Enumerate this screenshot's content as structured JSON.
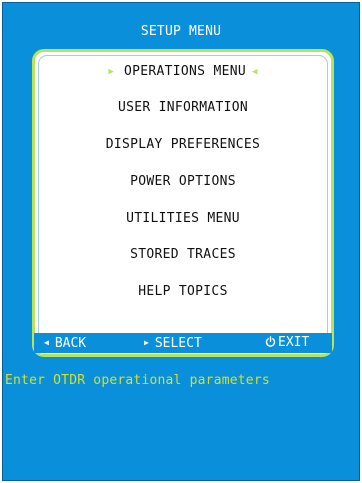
{
  "window_title": "SETUP MENU",
  "menu": {
    "items": [
      {
        "label": "OPERATIONS MENU",
        "selected": true
      },
      {
        "label": "USER INFORMATION",
        "selected": false
      },
      {
        "label": "DISPLAY PREFERENCES",
        "selected": false
      },
      {
        "label": "POWER OPTIONS",
        "selected": false
      },
      {
        "label": "UTILITIES MENU",
        "selected": false
      },
      {
        "label": "STORED TRACES",
        "selected": false
      },
      {
        "label": "HELP TOPICS",
        "selected": false
      }
    ]
  },
  "nav": {
    "back_label": "BACK",
    "select_label": "SELECT",
    "exit_label": "EXIT"
  },
  "status": {
    "message": "Enter OTDR operational parameters"
  },
  "colors": {
    "screen_background": "#0a90db",
    "panel_border": "#b9e35a",
    "message_text": "#d7df2a",
    "selection_arrows": "#b9e35a"
  },
  "icons": {
    "selected_left": "triangle-right-icon",
    "selected_right": "triangle-left-icon",
    "back": "triangle-left-icon",
    "select": "triangle-right-icon",
    "exit": "power-icon"
  }
}
